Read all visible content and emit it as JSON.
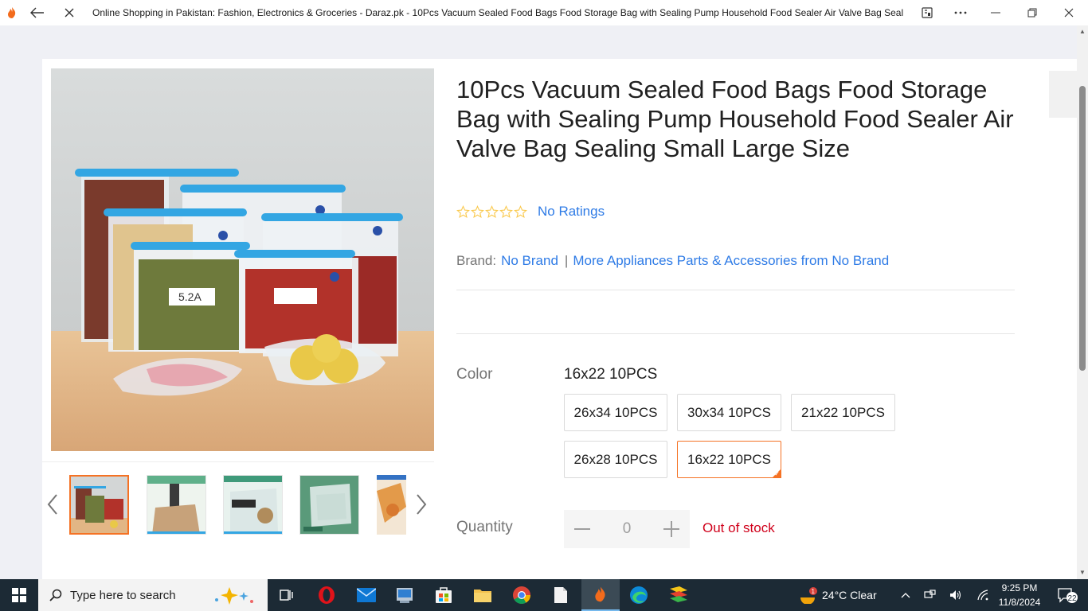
{
  "browser": {
    "tab_title": "Online Shopping in Pakistan: Fashion, Electronics & Groceries - Daraz.pk - 10Pcs Vacuum Sealed Food Bags Food Storage Bag with Sealing Pump Household Food Sealer Air Valve Bag Sealing Small Large Size"
  },
  "product": {
    "title": "10Pcs Vacuum Sealed Food Bags Food Storage Bag with Sealing Pump Household Food Sealer Air Valve Bag Sealing Small Large Size",
    "rating": {
      "stars_filled": 0,
      "stars_total": 5,
      "text": "No Ratings"
    },
    "brand": {
      "label": "Brand:",
      "value": "No Brand",
      "separator": "|",
      "more_link": "More Appliances Parts & Accessories from No Brand"
    },
    "color": {
      "label": "Color",
      "selected": "16x22 10PCS",
      "options": [
        "26x34 10PCS",
        "30x34 10PCS",
        "21x22 10PCS",
        "26x28 10PCS",
        "16x22 10PCS"
      ]
    },
    "quantity": {
      "label": "Quantity",
      "minus": "−",
      "value": "0",
      "plus": "+",
      "stock_status": "Out of stock"
    }
  },
  "gallery": {
    "thumbnail_count": 5,
    "active_index": 0,
    "main_image_labels": [
      "5.2A"
    ]
  },
  "taskbar": {
    "search_placeholder": "Type here to search",
    "weather": "24°C  Clear",
    "weather_badge": "1",
    "time": "9:25 PM",
    "date": "11/8/2024",
    "notifications": "22"
  },
  "colors": {
    "accent_orange": "#f57224",
    "link_blue": "#2e7be6",
    "out_of_stock_red": "#d0011b",
    "taskbar": "#1c2a35"
  }
}
